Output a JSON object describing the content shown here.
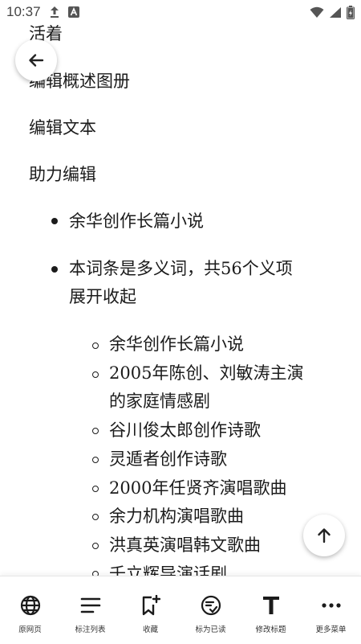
{
  "status_bar": {
    "time": "10:37",
    "icons": [
      "upload-icon",
      "app-notification-icon",
      "wifi-icon",
      "signal-icon",
      "battery-icon"
    ]
  },
  "content": {
    "lines": [
      "活着",
      "编辑概述图册",
      "编辑文本",
      "助力编辑"
    ],
    "bullets": [
      {
        "lines": [
          "余华创作长篇小说"
        ]
      },
      {
        "lines": [
          "本词条是多义词，共56个义项",
          "展开收起"
        ]
      }
    ],
    "sub_items": [
      {
        "lines": [
          "余华创作长篇小说"
        ]
      },
      {
        "lines": [
          "2005年陈创、刘敏涛主演",
          "的家庭情感剧"
        ]
      },
      {
        "lines": [
          "谷川俊太郎创作诗歌"
        ]
      },
      {
        "lines": [
          "灵遁者创作诗歌"
        ]
      },
      {
        "lines": [
          "2000年任贤齐演唱歌曲"
        ]
      },
      {
        "lines": [
          "余力机构演唱歌曲"
        ]
      },
      {
        "lines": [
          "洪真英演唱韩文歌曲"
        ]
      },
      {
        "lines": [
          "千立辉导演话剧"
        ]
      }
    ]
  },
  "toolbar": {
    "items": [
      {
        "label": "原网页",
        "icon": "globe-icon"
      },
      {
        "label": "标注列表",
        "icon": "list-icon"
      },
      {
        "label": "收藏",
        "icon": "bookmark-add-icon"
      },
      {
        "label": "标为已读",
        "icon": "mark-read-icon"
      },
      {
        "label": "修改标题",
        "icon": "text-title-icon"
      },
      {
        "label": "更多菜单",
        "icon": "more-icon"
      }
    ]
  }
}
